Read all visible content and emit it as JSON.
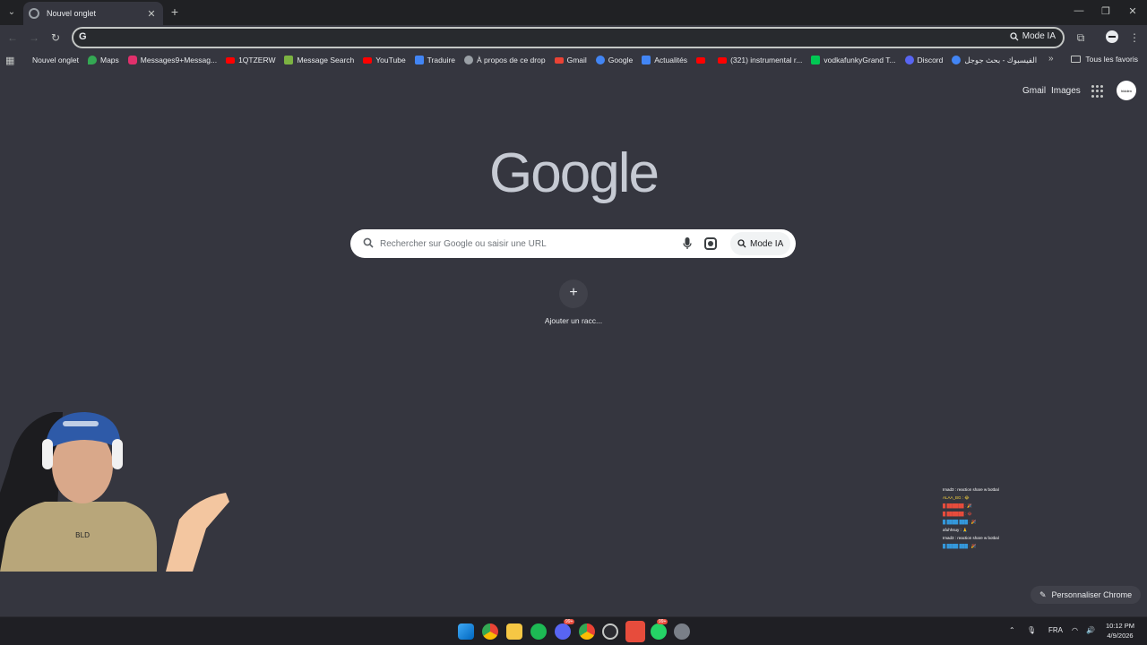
{
  "browser": {
    "tab_title": "Nouvel onglet",
    "omnibox_value": "",
    "omnibox_mode_label": "Mode IA"
  },
  "bookmarks": {
    "items": [
      {
        "label": "Nouvel onglet",
        "color": "#35363f"
      },
      {
        "label": "Maps",
        "color": "#34a853"
      },
      {
        "label": "Messages9+Messag...",
        "color": "#e1306c"
      },
      {
        "label": "1QTZERW",
        "color": "#ff0000"
      },
      {
        "label": "Message Search",
        "color": "#7cb342"
      },
      {
        "label": "YouTube",
        "color": "#ff0000"
      },
      {
        "label": "Traduire",
        "color": "#4285f4"
      },
      {
        "label": "À propos de ce drop",
        "color": "#9aa0a6"
      },
      {
        "label": "Gmail",
        "color": "#ea4335"
      },
      {
        "label": "Google",
        "color": "#4285f4"
      },
      {
        "label": "Actualités",
        "color": "#4285f4"
      },
      {
        "label": "",
        "color": "#ff0000"
      },
      {
        "label": "(321) instrumental r...",
        "color": "#ff0000"
      },
      {
        "label": "vodkafunkyGrand T...",
        "color": "#00c853"
      },
      {
        "label": "Discord",
        "color": "#5865f2"
      },
      {
        "label": "الفيسبوك - بحث جوجل",
        "color": "#4285f4"
      }
    ],
    "all_favorites": "Tous les favoris"
  },
  "ntp": {
    "gmail": "Gmail",
    "images": "Images",
    "logo": "Google",
    "search_placeholder": "Rechercher sur Google ou saisir une URL",
    "search_mode_label": "Mode IA",
    "add_shortcut_label": "Ajouter un racc...",
    "customize_label": "Personnaliser Chrome"
  },
  "chat_overlay": [
    {
      "text": "Imad3 : reaction share w botbal",
      "color": "#ffffff"
    },
    {
      "text": "ALAA_BG : 😂",
      "color": "#f4d03f"
    },
    {
      "text": "█ ██████ : 🎉",
      "color": "#e74c3c"
    },
    {
      "text": "█ ██████ : 😂",
      "color": "#e74c3c"
    },
    {
      "text": "█ ████ ███ : 🎉",
      "color": "#3498db"
    },
    {
      "text": "afuhhsuy : 🙏",
      "color": "#ffffff"
    },
    {
      "text": "Imad3 : reaction share w botbal",
      "color": "#ffffff"
    },
    {
      "text": "█ ████ ███ : 🎉",
      "color": "#3498db"
    }
  ],
  "taskbar": {
    "language": "FRA",
    "time": "10:12 PM",
    "date": "4/9/2026",
    "discord_badge": "99+",
    "whatsapp_badge": "99+"
  }
}
